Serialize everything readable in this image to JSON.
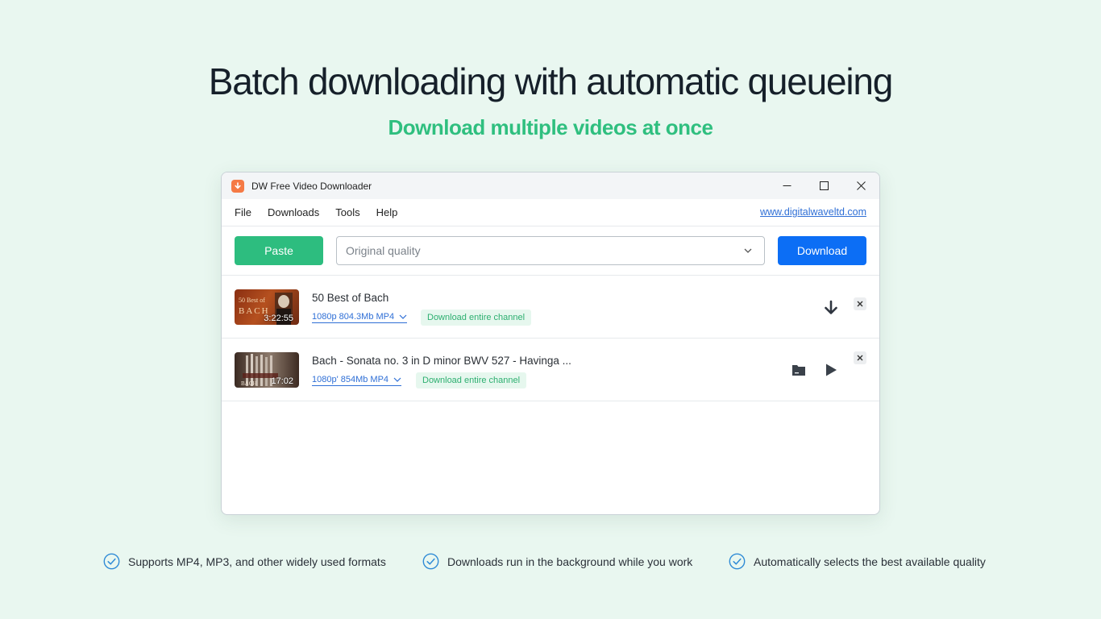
{
  "hero": {
    "headline": "Batch downloading with automatic queueing",
    "subheadline": "Download multiple videos at once"
  },
  "window": {
    "title": "DW Free Video Downloader",
    "menu": [
      "File",
      "Downloads",
      "Tools",
      "Help"
    ],
    "site_link": "www.digitalwaveltd.com"
  },
  "toolbar": {
    "paste_label": "Paste",
    "quality_value": "Original quality",
    "download_label": "Download"
  },
  "items": [
    {
      "title": "50 Best of Bach",
      "duration": "3:22:55",
      "format": "1080p 804.3Mb MP4",
      "channel_label": "Download entire channel",
      "thumb_text": "50 Best of BACH",
      "state": "queued"
    },
    {
      "title": "Bach - Sonata no. 3 in D minor BWV 527 - Havinga ...",
      "duration": "17:02",
      "format": "1080p' 854Mb MP4",
      "channel_label": "Download entire channel",
      "thumb_text": "BACH",
      "state": "downloaded"
    }
  ],
  "features": [
    "Supports MP4, MP3, and other widely used formats",
    "Downloads run in the background while you work",
    "Automatically selects the best available quality"
  ],
  "colors": {
    "background": "#e9f7f0",
    "accent_green": "#2fbf7f",
    "primary_blue": "#0c6ef5",
    "link_blue": "#2f6fd6"
  },
  "icons": {
    "app": "download-arrow-icon",
    "minimize": "minimize-icon",
    "maximize": "maximize-icon",
    "close": "close-icon",
    "feature_check": "check-circle-icon",
    "row1_action": "download-arrow-icon",
    "row2_actions": [
      "folder-icon",
      "play-icon"
    ]
  }
}
